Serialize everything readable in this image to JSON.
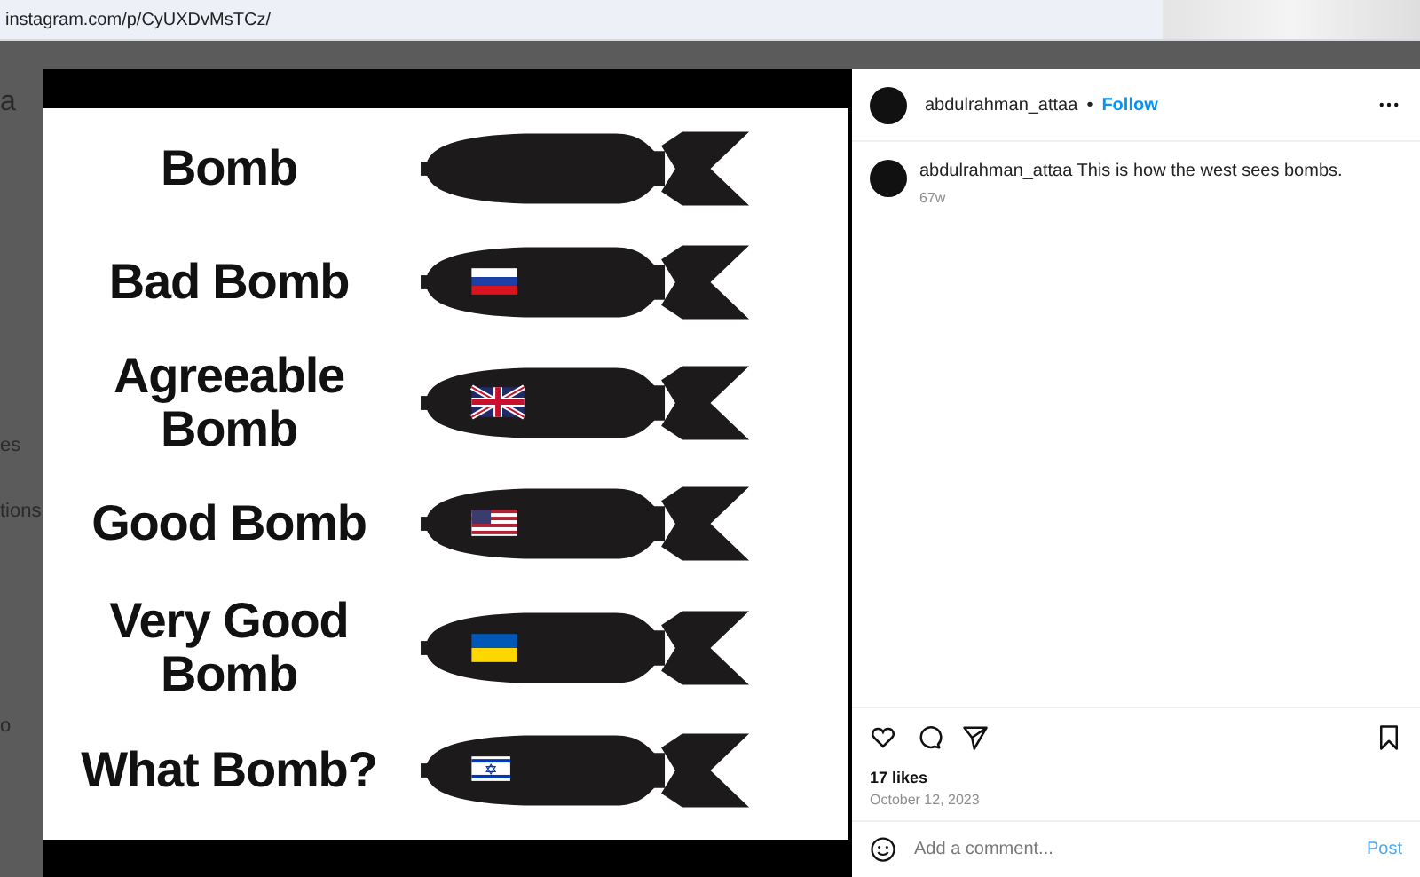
{
  "browser": {
    "url": "instagram.com/p/CyUXDvMsTCz/"
  },
  "background_fragments": [
    "a",
    "es",
    "tions",
    "o"
  ],
  "post_image": {
    "rows": [
      {
        "label": "Bomb",
        "kind": "plain"
      },
      {
        "label": "Bad Bomb",
        "kind": "russia"
      },
      {
        "label": "Agreeable Bomb",
        "kind": "uk"
      },
      {
        "label": "Good Bomb",
        "kind": "usa"
      },
      {
        "label": "Very Good Bomb",
        "kind": "ukraine"
      },
      {
        "label": "What Bomb?",
        "kind": "israel"
      }
    ]
  },
  "header": {
    "username": "abdulrahman_attaa",
    "separator": "•",
    "follow": "Follow"
  },
  "caption": {
    "username": "abdulrahman_attaa",
    "text": "This is how the west sees bombs.",
    "age": "67w"
  },
  "likes": "17 likes",
  "date": "October 12, 2023",
  "comment": {
    "placeholder": "Add a comment...",
    "post": "Post"
  }
}
